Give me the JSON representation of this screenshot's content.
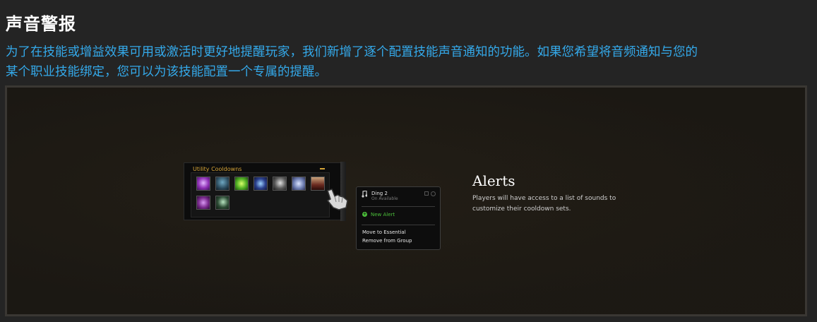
{
  "heading": "声音警报",
  "intro_line1": "为了在技能或增益效果可用或激活时更好地提醒玩家，我们新增了逐个配置技能声音通知的功能。如果您希望将音频通知与您的",
  "intro_line2": "某个职业技能绑定，您可以为该技能配置一个专属的提醒。",
  "cooldown_panel": {
    "title": "Utility Cooldowns",
    "icons": [
      {
        "name": "purple-demon-icon",
        "color": "#8e2fb5"
      },
      {
        "name": "shadow-figure-icon",
        "color": "#2b4a5c"
      },
      {
        "name": "green-burst-icon",
        "color": "#4fae24"
      },
      {
        "name": "blue-hands-icon",
        "color": "#2a3f8c"
      },
      {
        "name": "skeleton-icon",
        "color": "#5a5a5a"
      },
      {
        "name": "spectral-orb-icon",
        "color": "#6f7fb3"
      },
      {
        "name": "bone-cage-icon",
        "color": "#6b2a20"
      },
      {
        "name": "purple-tentacle-icon",
        "color": "#7a2a8e"
      },
      {
        "name": "dark-figure-icon",
        "color": "#2d4b35"
      }
    ]
  },
  "menu": {
    "sound_name": "Ding 2",
    "sound_condition": "On Available",
    "new_alert": "New Alert",
    "move": "Move to Essential",
    "remove": "Remove from Group"
  },
  "alerts": {
    "title": "Alerts",
    "description": "Players will have access to a list of sounds to customize their cooldown sets."
  },
  "colors": {
    "heading": "#ffffff",
    "intro": "#34a9ea",
    "panel_title": "#d6a437",
    "new_alert": "#4bbf3a"
  }
}
